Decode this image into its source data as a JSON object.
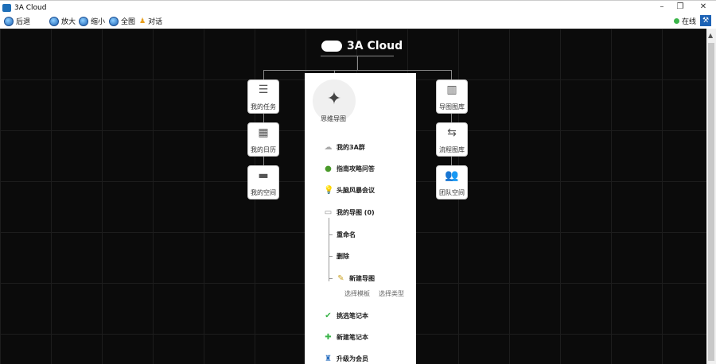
{
  "window": {
    "title": "3A Cloud",
    "minimize": "–",
    "maximize": "❐",
    "close": "✕"
  },
  "toolbar": {
    "back": "后退",
    "zoom_in": "放大",
    "zoom_out": "缩小",
    "full": "全图",
    "chat": "对话",
    "status": "在线"
  },
  "logo": {
    "text": "3A Cloud"
  },
  "left_cards": [
    {
      "label": "我的任务",
      "icon": "list-icon",
      "glyph": "☰"
    },
    {
      "label": "我的日历",
      "icon": "calendar-icon",
      "glyph": "▦"
    },
    {
      "label": "我的空间",
      "icon": "store-icon",
      "glyph": "▬"
    }
  ],
  "right_cards": [
    {
      "label": "导图图库",
      "icon": "books-icon",
      "glyph": "▥"
    },
    {
      "label": "流程图库",
      "icon": "swap-icon",
      "glyph": "⇆"
    },
    {
      "label": "团队空间",
      "icon": "team-icon",
      "glyph": "👥"
    }
  ],
  "hub": {
    "label": "思维导图",
    "icon": "compass-star-icon"
  },
  "menu": {
    "items": [
      {
        "label": "我的3A群",
        "icon": "cloud-icon"
      },
      {
        "label": "指南攻略问答",
        "icon": "globe-icon"
      },
      {
        "label": "头脑风暴会议",
        "icon": "bulb-icon"
      },
      {
        "label": "我的导图 (0)",
        "icon": "folder-icon"
      }
    ],
    "sub": {
      "rename": "重命名",
      "delete": "删除",
      "new_map": "新建导图",
      "choose_template": "选择模板",
      "choose_type": "选择类型"
    },
    "bottom": [
      {
        "label": "挑选笔记本",
        "icon": "check-icon"
      },
      {
        "label": "新建笔记本",
        "icon": "plus-icon"
      },
      {
        "label": "升级为会员",
        "icon": "bottle-icon"
      }
    ]
  },
  "colors": {
    "canvas": "#0b0b0b",
    "online": "#3bb54a",
    "accent": "#1c62b5"
  }
}
